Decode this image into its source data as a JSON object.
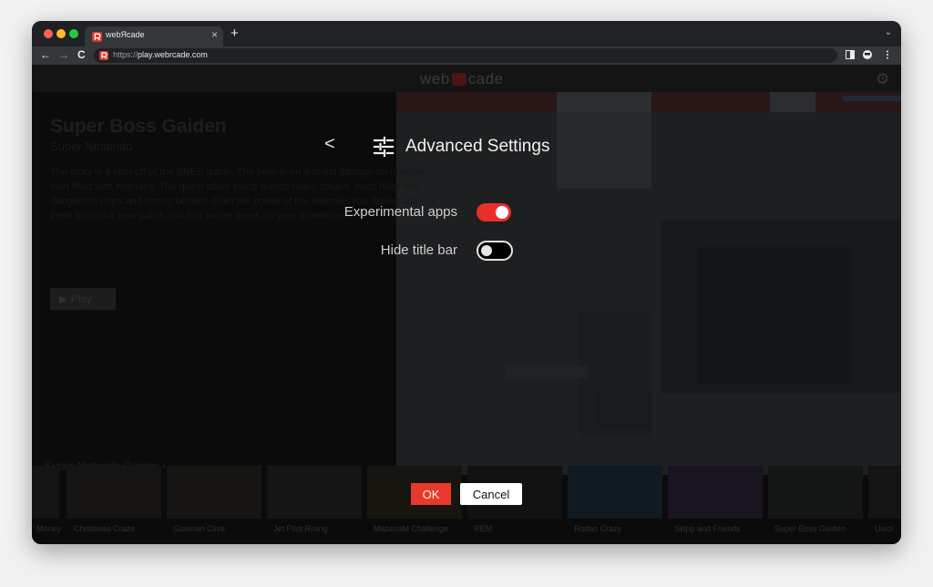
{
  "browser": {
    "tab_title": "webЯcade",
    "tab_close": "×",
    "new_tab": "+",
    "tab_menu": "⌄",
    "back": "←",
    "forward": "→",
    "reload": "C",
    "url_scheme": "https://",
    "url_host": "play.webrcade.com"
  },
  "app": {
    "brand_left": "web",
    "brand_right": "cade"
  },
  "background": {
    "hero_title": "Super Boss Gaiden",
    "hero_subtitle": "Super Nintendo",
    "hero_description": "The story is a spin-off of the SNES game. The hero is on a quest through an unknown land filled with enemies. The quest takes place across many stages, each filled with dangerous traps and strong bosses. Gain the power of the enemies you defeat and use them to unlock new paths and find secret areas on your adventure.",
    "play_label": "▶ Play",
    "row_title": "Super Nintendo Games ›",
    "games": [
      "Money",
      "Christmas Craze",
      "Gunman Clive",
      "Jet Pilot Rising",
      "MazezaM Challenge",
      "REM",
      "Rodas Crazy",
      "Skipp and Friends",
      "Super Boss Gaiden",
      "Uwol"
    ]
  },
  "dialog": {
    "back_icon": "<",
    "title": "Advanced Settings",
    "settings": [
      {
        "label": "Experimental apps",
        "enabled": true
      },
      {
        "label": "Hide title bar",
        "enabled": false
      }
    ],
    "ok_label": "OK",
    "cancel_label": "Cancel"
  },
  "colors": {
    "accent": "#e83a2c",
    "toggle_on": "#ea2f2a"
  }
}
